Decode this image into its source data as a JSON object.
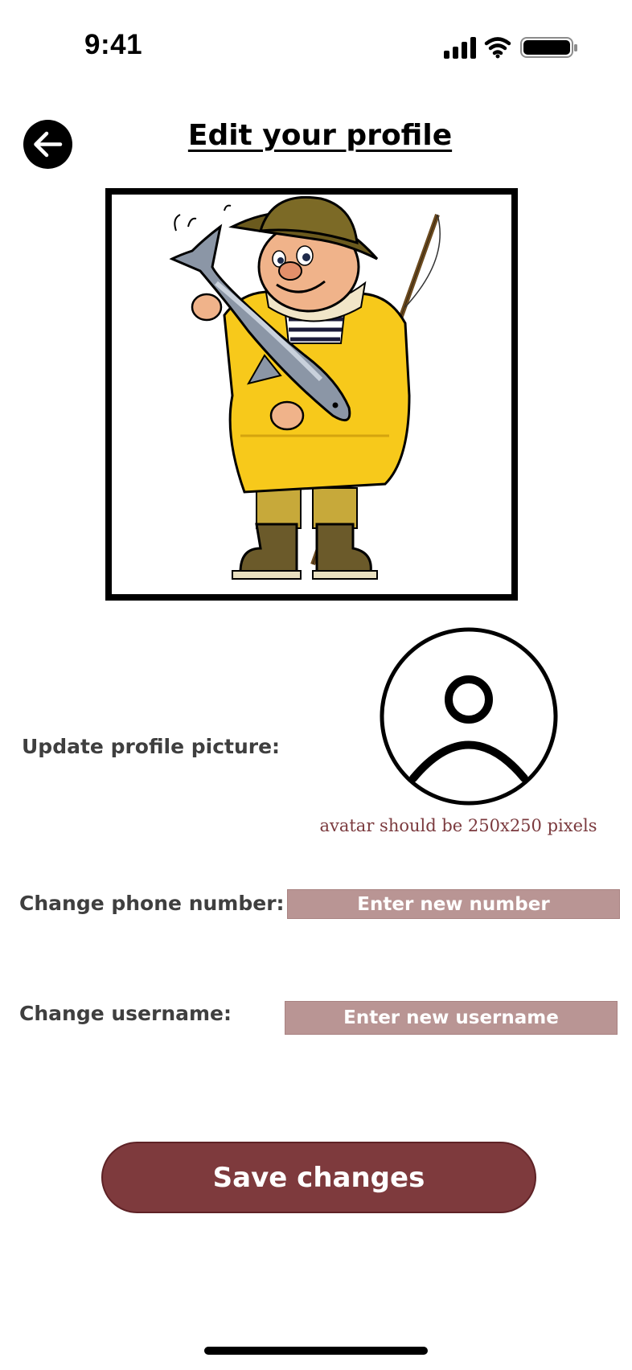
{
  "status_bar": {
    "time": "9:41",
    "icons": [
      "cellular-signal-icon",
      "wifi-icon",
      "battery-icon"
    ]
  },
  "header": {
    "back_icon": "arrow-left-icon",
    "title": "Edit your profile"
  },
  "profile_image": {
    "subject": "fisherman-illustration"
  },
  "avatar_section": {
    "label": "Update profile picture:",
    "avatar_icon": "user-avatar-icon",
    "hint": "avatar should be 250x250 pixels"
  },
  "phone_section": {
    "label": "Change phone number:",
    "placeholder": "Enter new number"
  },
  "username_section": {
    "label": "Change username:",
    "placeholder": "Enter new username"
  },
  "actions": {
    "save_label": "Save changes"
  },
  "colors": {
    "accent": "#7e3a3d",
    "input_bg": "#b99594",
    "hint_text": "#7b3a3e",
    "label_text": "#3f3f3f"
  }
}
